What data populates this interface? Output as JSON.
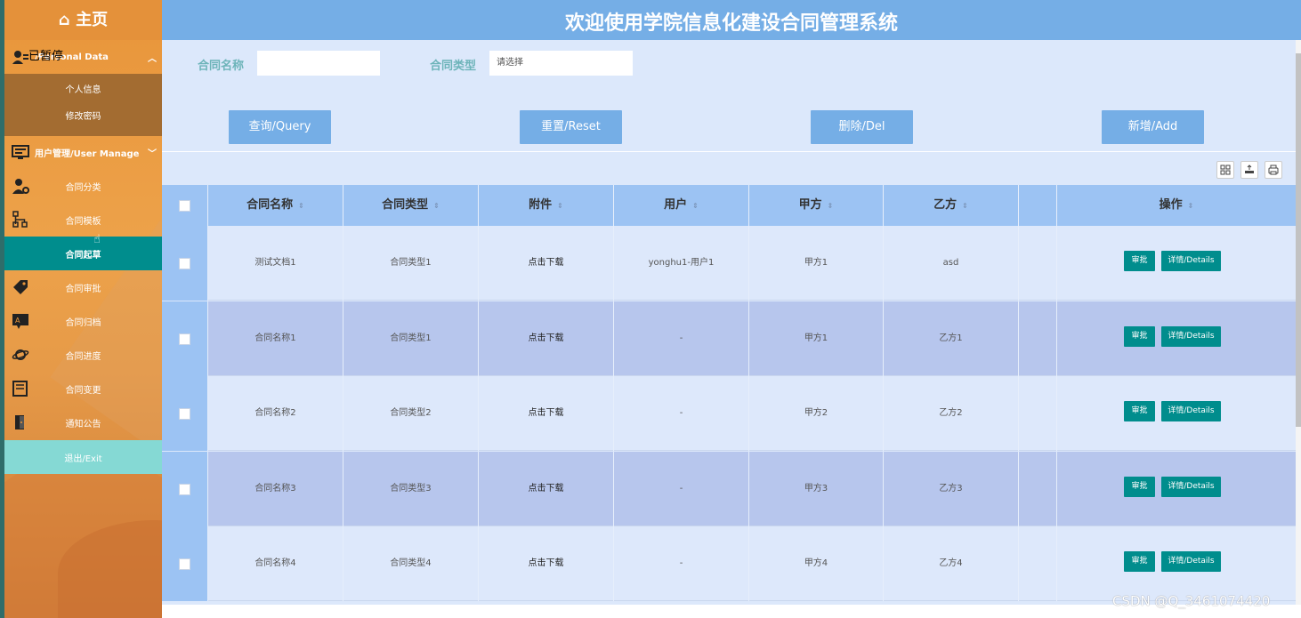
{
  "app": {
    "title": "欢迎使用学院信息化建设合同管理系统"
  },
  "sidebar": {
    "home": "⌂ 主页",
    "paused_overlay": "已暂停",
    "personal_group": "/Personal Data",
    "personal_items": [
      "个人信息",
      "修改密码"
    ],
    "user_group": "用户管理/User Manage",
    "items": [
      {
        "label": "合同分类",
        "icon": "user-gear-icon"
      },
      {
        "label": "合同模板",
        "icon": "org-chart-icon"
      },
      {
        "label": "合同起草",
        "icon": ""
      },
      {
        "label": "合同审批",
        "icon": "tag-icon"
      },
      {
        "label": "合同归档",
        "icon": "chat-translate-icon"
      },
      {
        "label": "合同进度",
        "icon": "planet-icon"
      },
      {
        "label": "合同变更",
        "icon": "book-icon"
      },
      {
        "label": "通知公告",
        "icon": "door-icon"
      }
    ],
    "exit": "退出/Exit"
  },
  "search": {
    "name_label": "合同名称",
    "name_value": "",
    "type_label": "合同类型",
    "type_placeholder": "请选择"
  },
  "buttons": {
    "query": "查询/Query",
    "reset": "重置/Reset",
    "delete": "删除/Del",
    "add": "新增/Add"
  },
  "table": {
    "headers": [
      "合同名称",
      "合同类型",
      "附件",
      "用户",
      "甲方",
      "乙方",
      "",
      "操作"
    ],
    "rows": [
      {
        "name": "测试文档1",
        "type": "合同类型1",
        "attachment": "点击下载",
        "user": "yonghu1-用户1",
        "party_a": "甲方1",
        "party_b": "asd"
      },
      {
        "name": "合同名称1",
        "type": "合同类型1",
        "attachment": "点击下载",
        "user": "-",
        "party_a": "甲方1",
        "party_b": "乙方1"
      },
      {
        "name": "合同名称2",
        "type": "合同类型2",
        "attachment": "点击下载",
        "user": "-",
        "party_a": "甲方2",
        "party_b": "乙方2"
      },
      {
        "name": "合同名称3",
        "type": "合同类型3",
        "attachment": "点击下载",
        "user": "-",
        "party_a": "甲方3",
        "party_b": "乙方3"
      },
      {
        "name": "合同名称4",
        "type": "合同类型4",
        "attachment": "点击下载",
        "user": "-",
        "party_a": "甲方4",
        "party_b": "乙方4"
      }
    ],
    "approve_label": "审批",
    "details_label": "详情/Details"
  },
  "watermark": "CSDN @Q_3461074420",
  "colors": {
    "header": "#75aee6",
    "sidebar": "#e8953a",
    "active": "#008d8d",
    "exit": "#85d9d4",
    "table_header": "#9cc3f3"
  }
}
